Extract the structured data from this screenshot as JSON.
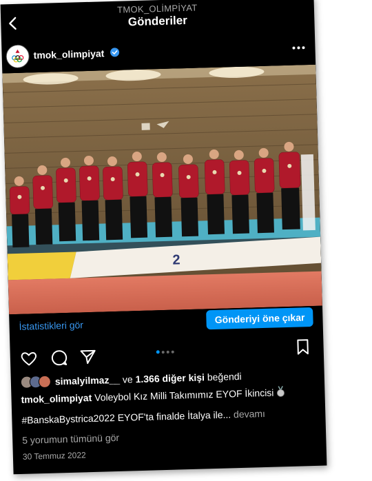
{
  "header": {
    "subtitle": "TMOK_OLİMPİYAT",
    "title": "Gönderiler"
  },
  "post": {
    "username": "tmok_olimpiyat",
    "caption_body": "Voleybol Kız Milli Takımımız EYOF İkincisi",
    "caption_line2": "#BanskaBystrica2022 EYOF'ta finalde İtalya ile...",
    "more_label": "devamı",
    "comments_label": "5 yorumun tümünü gör",
    "date": "30 Temmuz 2022",
    "podium_number": "2",
    "carousel_index": 1,
    "carousel_count": 4
  },
  "insights": {
    "stats_label": "İstatistikleri gör",
    "promote_label": "Gönderiyi öne çıkar"
  },
  "likes": {
    "liker": "simalyilmaz__",
    "middle": "ve",
    "count": "1.366 diğer kişi",
    "suffix": "beğendi"
  },
  "colors": {
    "accent": "#0095f6",
    "background": "#000000",
    "muted_text": "#a8a8a8"
  },
  "icons": {
    "back": "chevron-left-icon",
    "more": "more-horizontal-icon",
    "verified": "verified-badge-icon",
    "like": "heart-icon",
    "comment": "comment-icon",
    "share": "send-icon",
    "save": "bookmark-icon"
  }
}
